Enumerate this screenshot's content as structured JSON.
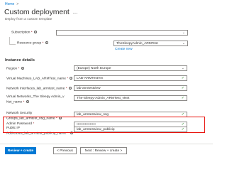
{
  "breadcrumb": {
    "home": "Home",
    "separator": ">"
  },
  "page": {
    "title": "Custom deployment",
    "more": "...",
    "subtitle": "Deploy from a custom template"
  },
  "project": {
    "subscription": {
      "label": "Subscription",
      "value": ""
    },
    "resource_group": {
      "label": "Resource group",
      "value": "TheSleepyAdmin_ARMTest",
      "create_new": "Create new"
    }
  },
  "instance": {
    "section_title": "Instance details",
    "region": {
      "label": "Region",
      "value": "(Europe) North Europe"
    },
    "vm_name": {
      "label": "Virtual Machines_LAB_ARMTest_name",
      "value": "LAB-ARMTestVm"
    },
    "nic_name": {
      "label": "Network Interfaces_lab_armtest_name",
      "value": "lab-armtestview"
    },
    "vnet_name": {
      "label_line1": "Virtual Networks_The Sleepy Admin_v",
      "label_line2": "Net_name",
      "value": "The-Sleepy-Admin_ARMTest_vNet"
    },
    "nsg_name": {
      "label_line1": "Network Security",
      "label_line2": "Groups_lab_armtest_nsg_name",
      "value": "lab_armtestview_nsg"
    },
    "public_ip_name": {
      "label_line1": "Public IP",
      "label_line2": "Addresses_lab_armtest_publicip_name",
      "value": "lab_armtestview_publicip"
    },
    "admin_password": {
      "label": "Admin Password",
      "value": "••••••••••••••••"
    }
  },
  "footer": {
    "review_create": "Review + create",
    "previous": "< Previous",
    "next": "Next : Review + create >"
  },
  "icons": {
    "check": "check-icon",
    "chevron": "chevron-down-icon",
    "info": "info-icon"
  },
  "colors": {
    "accent": "#0078d4",
    "required": "#a4262c",
    "valid": "#107c10",
    "highlight": "#e8120c"
  }
}
